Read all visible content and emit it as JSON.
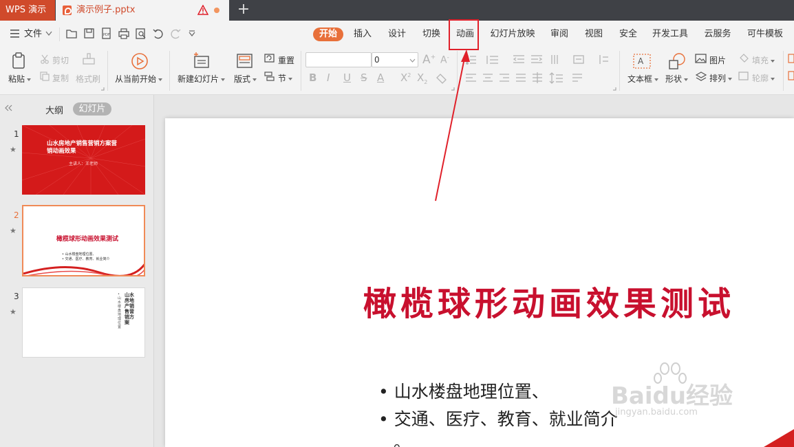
{
  "titlebar": {
    "app_name": "WPS 演示",
    "doc_name": "演示例子.pptx",
    "new_tab": "+"
  },
  "menubar": {
    "file_label": "文件",
    "tabs": [
      "开始",
      "插入",
      "设计",
      "切换",
      "动画",
      "幻灯片放映",
      "审阅",
      "视图",
      "安全",
      "开发工具",
      "云服务",
      "可牛模板"
    ]
  },
  "ribbon": {
    "paste": "粘贴",
    "cut": "剪切",
    "copy": "复制",
    "format_painter": "格式刷",
    "start_from_current": "从当前开始",
    "new_slide": "新建幻灯片",
    "layout": "版式",
    "reset": "重置",
    "section": "节",
    "font_size_value": "0",
    "text_box": "文本框",
    "shape": "形状",
    "picture": "图片",
    "arrange": "排列",
    "fill": "填充",
    "outline": "轮廓"
  },
  "leftpanel": {
    "tab_outline": "大纲",
    "tab_slides": "幻灯片",
    "slides": [
      {
        "num": "1",
        "title": "山水房地产销售营销方案营销动画效果",
        "presenter": "主讲人：王老师"
      },
      {
        "num": "2",
        "title": "橄榄球形动画效果测试",
        "lines": [
          "• 山水楼盘地理位置、",
          "• 交通、医疗、教育、就业简介"
        ]
      },
      {
        "num": "3",
        "title": "山水房地产销售营销方案",
        "lines": [
          "• 山水楼盘地理位置"
        ]
      }
    ]
  },
  "slide": {
    "title": "橄榄球形动画效果测试",
    "bullets": [
      "山水楼盘地理位置、",
      "交通、医疗、教育、就业简介",
      "。"
    ]
  },
  "watermark": {
    "brand": "Baidu经验",
    "url": "jingyan.baidu.com"
  },
  "colors": {
    "accent": "#e8703a",
    "brand_red": "#d04a2b",
    "title_red": "#c8102e",
    "highlight": "#e0202a"
  }
}
